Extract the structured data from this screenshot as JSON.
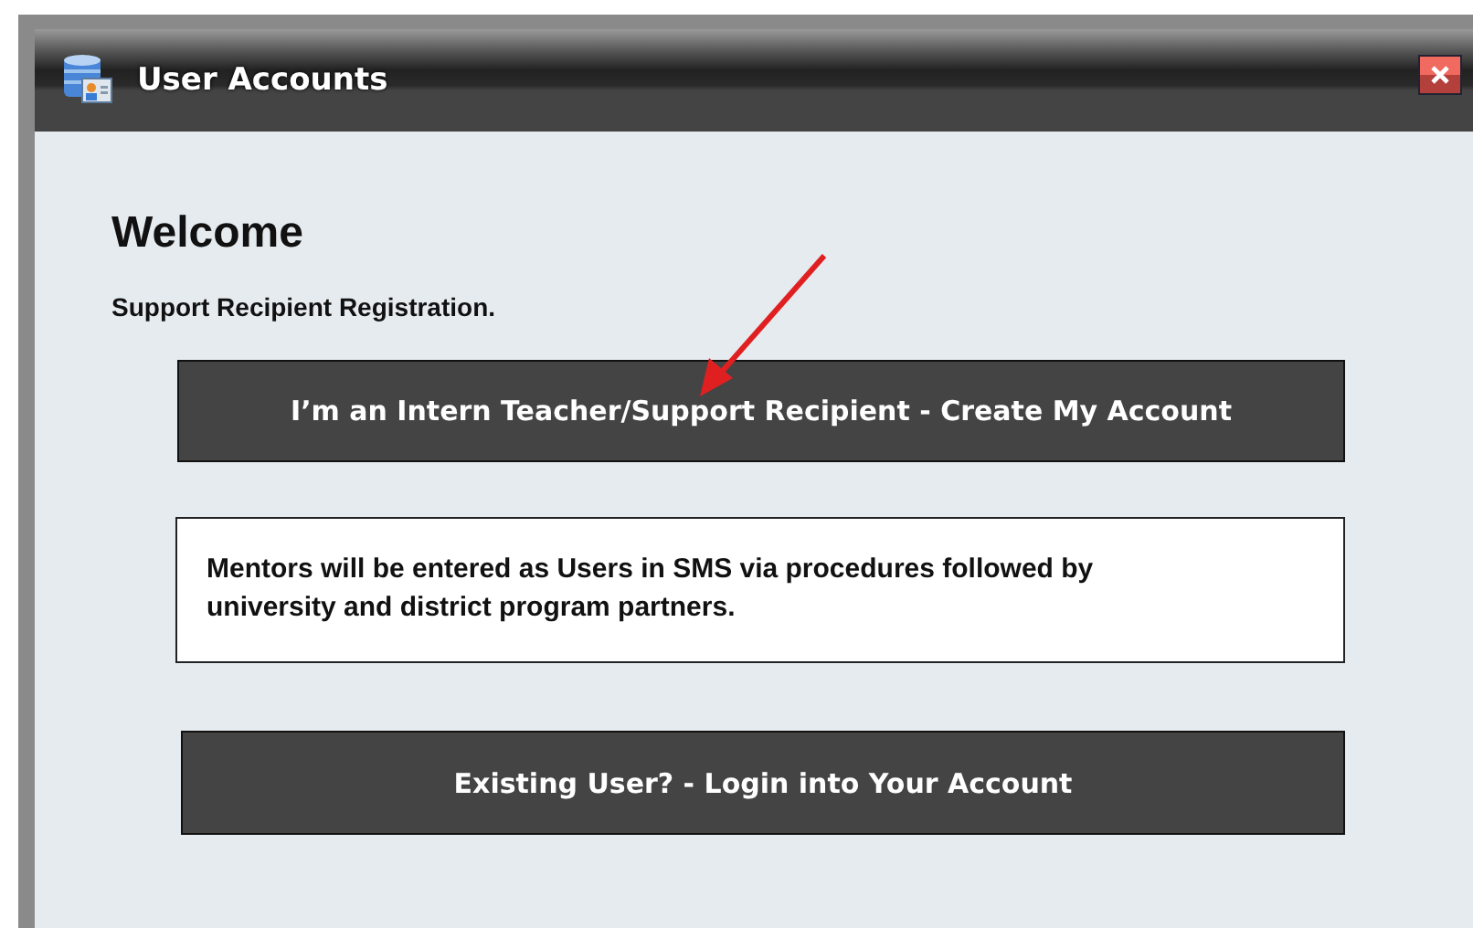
{
  "window": {
    "title": "User Accounts"
  },
  "heading": "Welcome",
  "subtitle": "Support Recipient Registration.",
  "buttons": [
    {
      "label": "I’m an Intern Teacher/Support Recipient - Create My Account"
    }
  ],
  "notice": "Mentors will be entered as Users in SMS via procedures followed by university and district program partners.",
  "login_button": {
    "label": "Existing User? - Login into Your Account"
  }
}
